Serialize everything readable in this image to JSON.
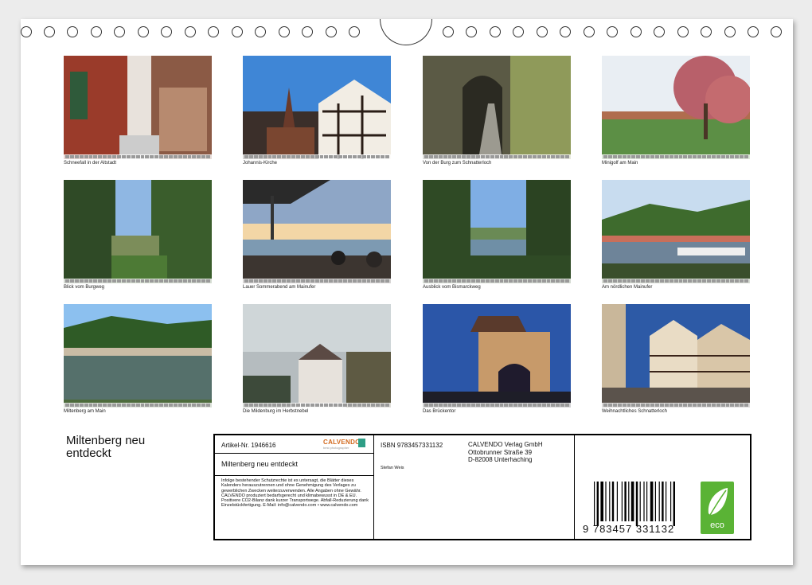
{
  "calendar": {
    "title": "Miltenberg neu entdeckt",
    "photos": [
      {
        "caption": "Schneefall in der Altstadt",
        "scene": "street-snow"
      },
      {
        "caption": "Johannis-Kirche",
        "scene": "church"
      },
      {
        "caption": "Von der Burg zum Schnatterloch",
        "scene": "arch"
      },
      {
        "caption": "Minigolf am Main",
        "scene": "tree-bridge"
      },
      {
        "caption": "Blick vom Burgweg",
        "scene": "forest-view"
      },
      {
        "caption": "Lauer Sommerabend am Mainufer",
        "scene": "sunset-river"
      },
      {
        "caption": "Ausblick vom Bismarckweg",
        "scene": "view-branches"
      },
      {
        "caption": "Am nördlichen Mainufer",
        "scene": "riverbank"
      },
      {
        "caption": "Miltenberg am Main",
        "scene": "river-town"
      },
      {
        "caption": "Die Mildenburg im Herbstnebel",
        "scene": "fog-castle"
      },
      {
        "caption": "Das Brückentor",
        "scene": "gate-night"
      },
      {
        "caption": "Weihnachtliches Schnatterloch",
        "scene": "xmas-square"
      }
    ]
  },
  "info": {
    "article_label": "Artikel-Nr. 1946616",
    "calvendo_logo": "CALVENDO",
    "calvendo_sub": "best photographer",
    "calendar_title": "Miltenberg neu entdeckt",
    "legal_text": "Infolge bestehender Schutzrechte ist es untersagt, die Blätter dieses Kalenders herauszutrennen und ohne Genehmigung des Verlages zu gewerblichen Zwecken weiterzuverwenden. Alle Angaben ohne Gewähr. CALVENDO produziert bedarfsgerecht und klimabewusst in DE & EU. Positivere CO2-Bilanz dank kurzer Transportwege. Abfall-Reduzierung dank Einzelstückfertigung. E-Mail: info@calvendo.com • www.calvendo.com",
    "isbn": "ISBN 9783457331132",
    "publisher": [
      "CALVENDO Verlag GmbH",
      "Ottobrunner Straße 39",
      "D-82008 Unterhaching"
    ],
    "author": "Stefan Weis",
    "barcode_number": "9 783457 331132",
    "eco_label": "eco"
  }
}
